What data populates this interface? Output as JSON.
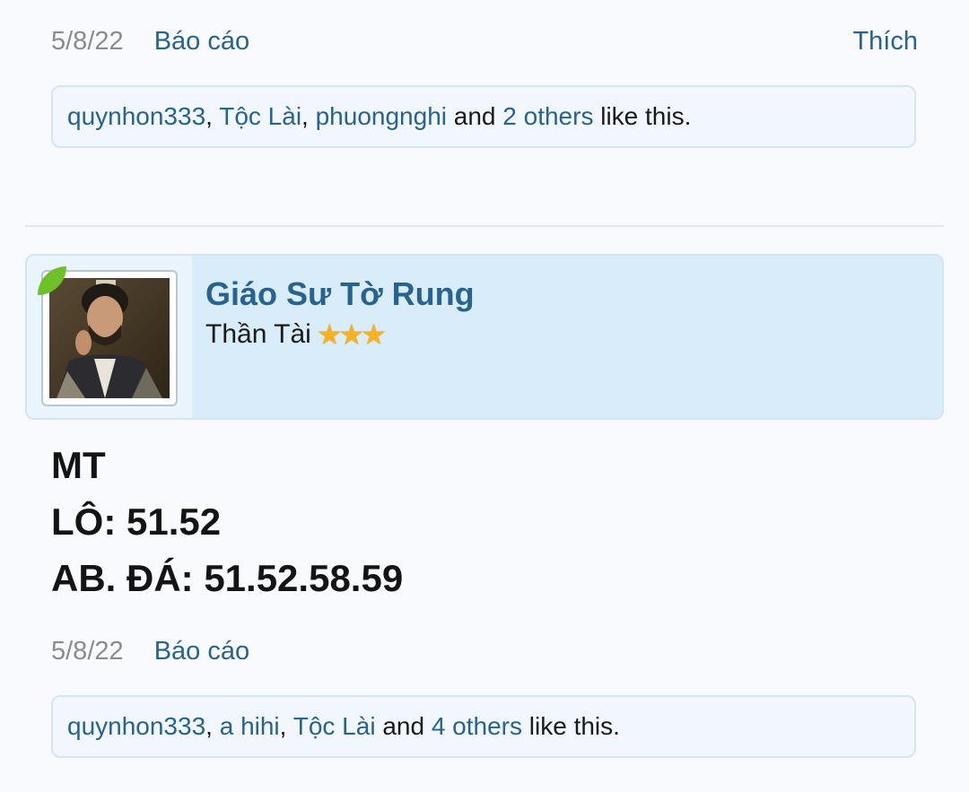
{
  "post1": {
    "date": "5/8/22",
    "report_label": "Báo cáo",
    "like_label": "Thích",
    "likes": {
      "users": [
        "quynhon333",
        "Tộc Lài",
        "phuongnghi"
      ],
      "sep": ", ",
      "and_text": " and ",
      "others_link": "2 others",
      "tail": " like this."
    }
  },
  "post2": {
    "author": {
      "name": "Giáo Sư Tờ Rung",
      "title": "Thần Tài",
      "stars": "★★★",
      "star_count": 3,
      "avatar_icon": "user-avatar-photo",
      "badge_icon": "green-leaf-icon"
    },
    "message": {
      "line1": "MT",
      "line2": "LÔ: 51.52",
      "line3": "AB. ĐÁ: 51.52.58.59"
    },
    "date": "5/8/22",
    "report_label": "Báo cáo",
    "likes": {
      "users": [
        "quynhon333",
        "a hihi",
        "Tộc Lài"
      ],
      "sep": ", ",
      "and_text": " and ",
      "others_link": "4 others",
      "tail": " like this."
    }
  },
  "colors": {
    "link": "#28628e",
    "header_bg": "#d9ecfa",
    "page_bg": "#f8fafd",
    "star": "#f5b324",
    "leaf": "#6fc02a"
  }
}
